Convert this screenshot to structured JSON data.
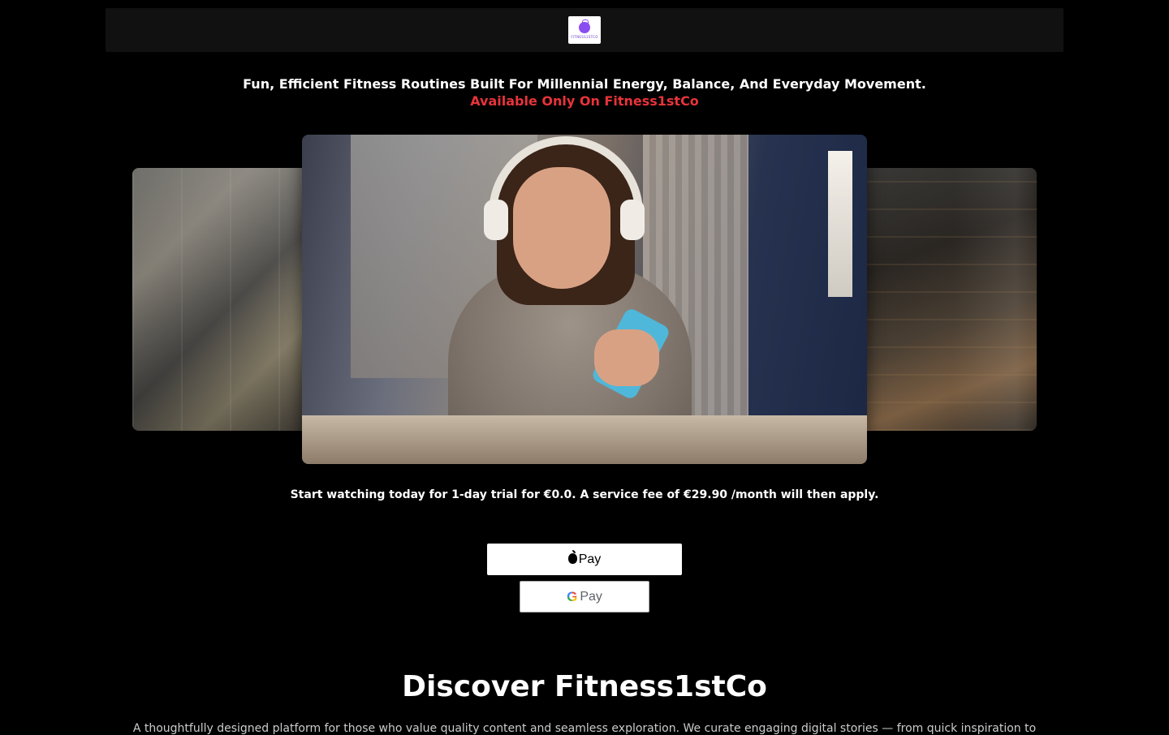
{
  "header": {
    "logo_text": "FITNESS1STCO",
    "logo_icon": "kettlebell-logo-icon",
    "logo_color": "#8a4df0"
  },
  "hero": {
    "headline": "Fun, Efficient Fitness Routines Built For Millennial Energy, Balance, And Everyday Movement.",
    "subheadline": "Available Only On Fitness1stCo",
    "accent_color": "#e8333a"
  },
  "carousel": {
    "slides": [
      "slide-left",
      "slide-main",
      "slide-right"
    ]
  },
  "offer": {
    "trial_text": "Start watching today for 1-day trial for €0.0. A service fee of €29.90 /month will then apply."
  },
  "payments": {
    "apple_label": "Pay",
    "google_g": "G",
    "google_label": "Pay"
  },
  "about": {
    "title": "Discover Fitness1stCo",
    "description": "A thoughtfully designed platform for those who value quality content and seamless exploration. We curate engaging digital stories — from quick inspiration to"
  }
}
